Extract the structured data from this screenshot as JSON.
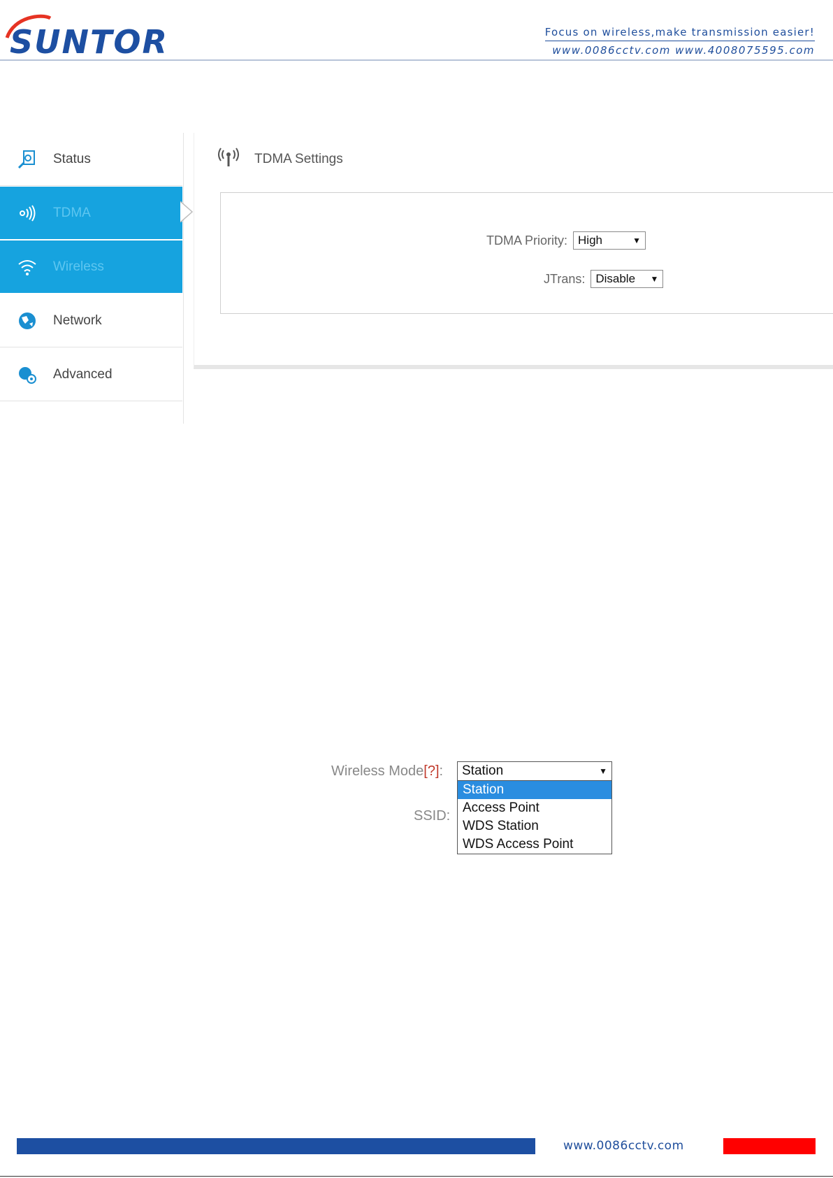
{
  "header": {
    "logo_text": "SUNTOR",
    "tagline": "Focus on wireless,make transmission easier!",
    "websites": "www.0086cctv.com  www.4008075595.com"
  },
  "router_ui": {
    "sidebar": [
      {
        "label": "Status",
        "icon": "status-magnifier-icon",
        "active": false
      },
      {
        "label": "TDMA",
        "icon": "tdma-signal-icon",
        "active": true
      },
      {
        "label": "Wireless",
        "icon": "wifi-icon",
        "active": true
      },
      {
        "label": "Network",
        "icon": "globe-icon",
        "active": false
      },
      {
        "label": "Advanced",
        "icon": "advanced-gear-icon",
        "active": false
      }
    ],
    "section_title": "TDMA Settings",
    "fields": {
      "tdma_priority": {
        "label": "TDMA Priority:",
        "value": "High"
      },
      "jtrans": {
        "label": "JTrans:",
        "value": "Disable"
      }
    }
  },
  "wireless_dropdown": {
    "mode_label": "Wireless Mode",
    "help_marker": "[?]",
    "colon": ":",
    "selected": "Station",
    "options": [
      "Station",
      "Access Point",
      "WDS Station",
      "WDS Access Point"
    ],
    "ssid_label": "SSID:"
  },
  "footer": {
    "url": "www.0086cctv.com"
  },
  "colors": {
    "brand_blue": "#1d4fa2",
    "active_nav": "#16a3df",
    "footer_red": "#ff0000",
    "selection_blue": "#2a8de0"
  }
}
